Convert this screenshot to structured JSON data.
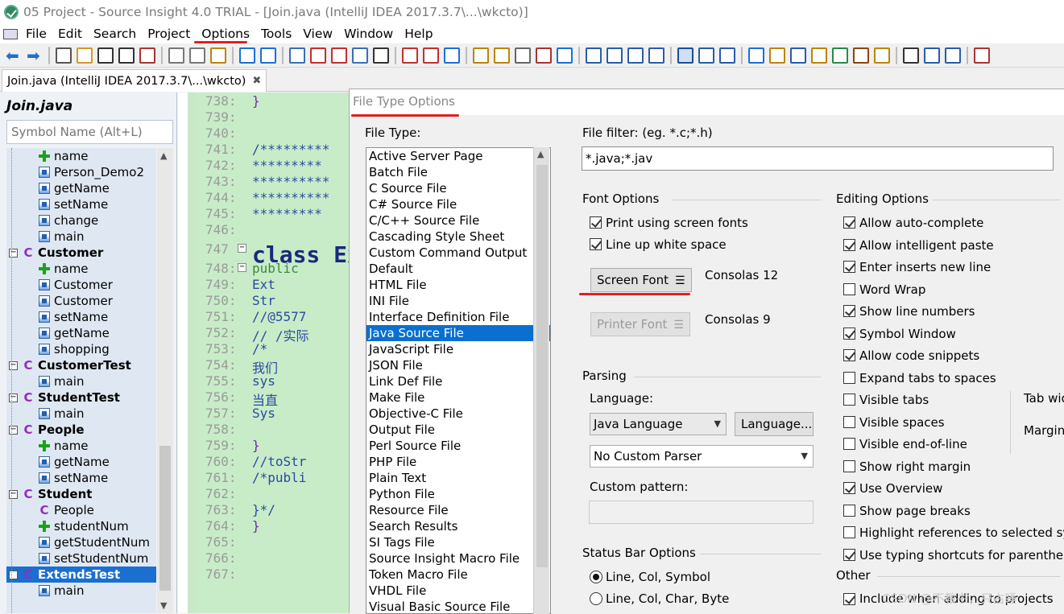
{
  "window": {
    "title": "05 Project - Source Insight 4.0 TRIAL - [Join.java (IntelliJ IDEA 2017.3.7\\...\\wkcto)]"
  },
  "menu": [
    "File",
    "Edit",
    "Search",
    "Project",
    "Options",
    "Tools",
    "View",
    "Window",
    "Help"
  ],
  "tab": {
    "label": "Join.java (IntelliJ IDEA 2017.3.7\\...\\wkcto)",
    "close": "✖"
  },
  "symbol_panel": {
    "title": "Join.java",
    "search_placeholder": "Symbol Name (Alt+L)",
    "items": [
      {
        "label": "name",
        "kind": "field",
        "indent": 2
      },
      {
        "label": "Person_Demo2",
        "kind": "method",
        "indent": 2
      },
      {
        "label": "getName",
        "kind": "method",
        "indent": 2
      },
      {
        "label": "setName",
        "kind": "method",
        "indent": 2
      },
      {
        "label": "change",
        "kind": "method",
        "indent": 2
      },
      {
        "label": "main",
        "kind": "method",
        "indent": 2
      },
      {
        "label": "Customer",
        "kind": "class",
        "indent": 1
      },
      {
        "label": "name",
        "kind": "field",
        "indent": 2
      },
      {
        "label": "Customer",
        "kind": "method",
        "indent": 2
      },
      {
        "label": "Customer",
        "kind": "method",
        "indent": 2
      },
      {
        "label": "setName",
        "kind": "method",
        "indent": 2
      },
      {
        "label": "getName",
        "kind": "method",
        "indent": 2
      },
      {
        "label": "shopping",
        "kind": "method",
        "indent": 2
      },
      {
        "label": "CustomerTest",
        "kind": "class",
        "indent": 1
      },
      {
        "label": "main",
        "kind": "method",
        "indent": 2
      },
      {
        "label": "StudentTest",
        "kind": "class",
        "indent": 1
      },
      {
        "label": "main",
        "kind": "method",
        "indent": 2
      },
      {
        "label": "People",
        "kind": "class",
        "indent": 1
      },
      {
        "label": "name",
        "kind": "field",
        "indent": 2
      },
      {
        "label": "getName",
        "kind": "method",
        "indent": 2
      },
      {
        "label": "setName",
        "kind": "method",
        "indent": 2
      },
      {
        "label": "Student",
        "kind": "class",
        "indent": 1
      },
      {
        "label": "People",
        "kind": "classref",
        "indent": 2
      },
      {
        "label": "studentNum",
        "kind": "field",
        "indent": 2
      },
      {
        "label": "getStudentNum",
        "kind": "method",
        "indent": 2
      },
      {
        "label": "setStudentNum",
        "kind": "method",
        "indent": 2
      },
      {
        "label": "ExtendsTest",
        "kind": "class",
        "indent": 1,
        "selected": true
      },
      {
        "label": "main",
        "kind": "method",
        "indent": 2
      }
    ]
  },
  "editor": {
    "lines": [
      {
        "n": "738:",
        "code": "}"
      },
      {
        "n": "739:",
        "code": ""
      },
      {
        "n": "740:",
        "code": ""
      },
      {
        "n": "741:",
        "code": "/*********"
      },
      {
        "n": "742:",
        "code": " *********"
      },
      {
        "n": "743:",
        "code": "**********"
      },
      {
        "n": "744:",
        "code": "**********"
      },
      {
        "n": "745:",
        "code": " *********"
      },
      {
        "n": "746:",
        "code": ""
      },
      {
        "n": "747",
        "code": "class Ext"
      },
      {
        "n": "748:",
        "code": "    public"
      },
      {
        "n": "749:",
        "code": "        Ext"
      },
      {
        "n": "750:",
        "code": "        Str"
      },
      {
        "n": "751:",
        "code": "    //@5577"
      },
      {
        "n": "752:",
        "code": "    // /实际"
      },
      {
        "n": "753:",
        "code": "    /*"
      },
      {
        "n": "754:",
        "code": "        我们"
      },
      {
        "n": "755:",
        "code": "        sys"
      },
      {
        "n": "756:",
        "code": "        当直"
      },
      {
        "n": "757:",
        "code": "        Sys"
      },
      {
        "n": "758:",
        "code": ""
      },
      {
        "n": "759:",
        "code": "    }"
      },
      {
        "n": "760:",
        "code": "    //toStr"
      },
      {
        "n": "761:",
        "code": "    /*publi"
      },
      {
        "n": "762:",
        "code": ""
      },
      {
        "n": "763:",
        "code": "    }*/"
      },
      {
        "n": "764:",
        "code": "}"
      },
      {
        "n": "765:",
        "code": ""
      },
      {
        "n": "766:",
        "code": ""
      },
      {
        "n": "767:",
        "code": ""
      }
    ]
  },
  "dialog": {
    "title": "File Type Options",
    "file_type_label": "File Type:",
    "file_types": [
      "Active Server Page",
      "Batch File",
      "C Source File",
      "C# Source File",
      "C/C++ Source File",
      "Cascading Style Sheet",
      "Custom Command Output",
      "Default",
      "HTML File",
      "INI File",
      "Interface Definition File",
      "Java Source File",
      "JavaScript File",
      "JSON File",
      "Link Def File",
      "Make File",
      "Objective-C File",
      "Output File",
      "Perl Source File",
      "PHP File",
      "Plain Text",
      "Python File",
      "Resource File",
      "Search Results",
      "SI Tags File",
      "Source Insight Macro File",
      "Token Macro File",
      "VHDL File",
      "Visual Basic Source File"
    ],
    "selected_file_type": "Java Source File",
    "filter_label": "File filter: (eg. *.c;*.h)",
    "filter_value": "*.java;*.jav",
    "font_options": {
      "heading": "Font Options",
      "print_screen_fonts": {
        "label": "Print using screen fonts",
        "checked": true
      },
      "line_up_white": {
        "label": "Line up white space",
        "checked": true
      },
      "screen_font_btn": "Screen Font",
      "screen_font_value": "Consolas 12",
      "printer_font_btn": "Printer Font",
      "printer_font_value": "Consolas 9"
    },
    "parsing": {
      "heading": "Parsing",
      "language_label": "Language:",
      "language_value": "Java Language",
      "language_btn": "Language...",
      "parser_value": "No Custom Parser",
      "custom_pattern_label": "Custom pattern:"
    },
    "status_bar": {
      "heading": "Status Bar Options",
      "opt1": {
        "label": "Line, Col, Symbol",
        "checked": true
      },
      "opt2": {
        "label": "Line, Col, Char, Byte",
        "checked": false
      }
    },
    "editing": {
      "heading": "Editing Options",
      "options": [
        {
          "label": "Allow auto-complete",
          "checked": true
        },
        {
          "label": "Allow intelligent paste",
          "checked": true
        },
        {
          "label": "Enter inserts new line",
          "checked": true
        },
        {
          "label": "Word Wrap",
          "checked": false
        },
        {
          "label": "Show line numbers",
          "checked": true
        },
        {
          "label": "Symbol Window",
          "checked": true
        },
        {
          "label": "Allow code snippets",
          "checked": true
        },
        {
          "label": "Expand tabs to spaces",
          "checked": false
        },
        {
          "label": "Visible tabs",
          "checked": false
        },
        {
          "label": "Visible spaces",
          "checked": false
        },
        {
          "label": "Visible end-of-line",
          "checked": false
        },
        {
          "label": "Show right margin",
          "checked": false
        },
        {
          "label": "Use Overview",
          "checked": true
        },
        {
          "label": "Show page breaks",
          "checked": false
        },
        {
          "label": "Highlight references to selected sy",
          "checked": false
        },
        {
          "label": "Use typing shortcuts for parenthese",
          "checked": true
        }
      ],
      "tab_width_label": "Tab wid",
      "margin_label": "Margin"
    },
    "other": {
      "heading": "Other",
      "include_when_adding": {
        "label": "Include when adding to projects",
        "checked": true
      }
    }
  },
  "watermark": "CSDN @不教书，只占睡"
}
